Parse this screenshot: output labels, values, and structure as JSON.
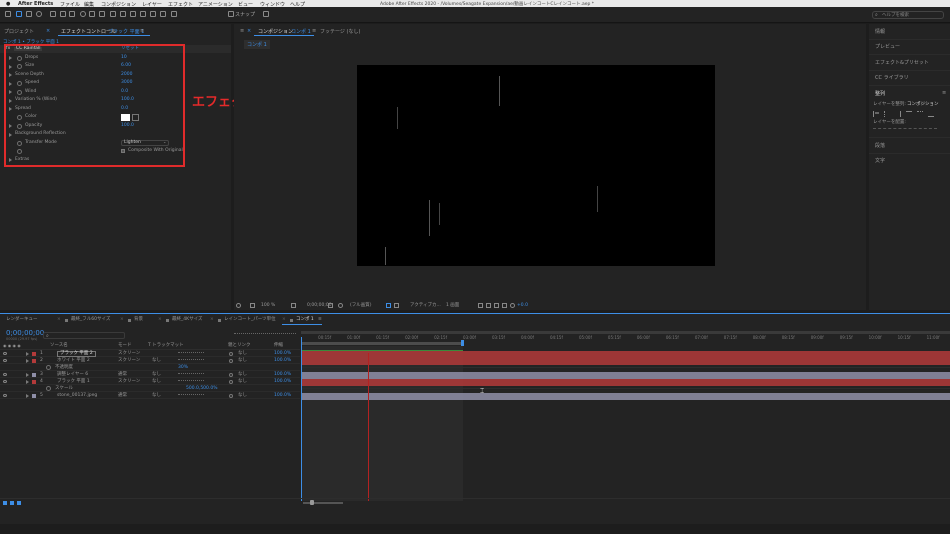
{
  "menubar": {
    "app_name": "After Effects",
    "items": [
      "ファイル",
      "編集",
      "コンポジション",
      "レイヤー",
      "エフェクト",
      "アニメーション",
      "ビュー",
      "ウィンドウ",
      "ヘルプ"
    ],
    "title": "Adobe After Effects 2020 - /Volumes/Seagate Expansion/ae/動画レインコートCレインコート.aep *"
  },
  "toolbar": {
    "snap_label": "スナップ",
    "search_placeholder": "ヘルプを検索"
  },
  "project_panel": {
    "tab_project": "プロジェクト",
    "tab_effect_controls": "エフェクトコントロール",
    "effect_layer": "ブラック 平面 1",
    "breadcrumb": "コンポ 1 • ブラック 平面 1",
    "effect_name": "CC Rainfall",
    "reset_label": "リセット",
    "params": [
      {
        "name": "Drops",
        "value": "10"
      },
      {
        "name": "Size",
        "value": "6.00"
      },
      {
        "name": "Scene Depth",
        "value": "2000"
      },
      {
        "name": "Speed",
        "value": "3000"
      },
      {
        "name": "Wind",
        "value": "0.0"
      },
      {
        "name": "Variation % (Wind)",
        "value": "100.0"
      },
      {
        "name": "Spread",
        "value": "0.0"
      },
      {
        "name": "Color",
        "value": ""
      },
      {
        "name": "Opacity",
        "value": "100.0"
      },
      {
        "name": "Background Reflection",
        "value": ""
      },
      {
        "name": "Transfer Mode",
        "value": "Lighten"
      },
      {
        "name": "",
        "value": "Composite With Original"
      },
      {
        "name": "Extras",
        "value": ""
      }
    ],
    "annotation": "エフェクト設定"
  },
  "composition_panel": {
    "tab_composition": "コンポジション",
    "comp_name": "コンポ 1",
    "tab_footage": "フッテージ (なし)",
    "sub_tab": "コンポ 1",
    "zoom": "100 %",
    "timecode": "0;00;00;00",
    "resolution": "(フル画質)",
    "camera": "アクティブカ...",
    "views": "1 画面",
    "offset": "+0.0"
  },
  "right_panel": {
    "items": [
      "情報",
      "プレビュー",
      "エフェクト&プリセット",
      "CC ライブラリ",
      "整列"
    ],
    "align_to_label": "レイヤーを整列:",
    "align_to_value": "コンポジション",
    "distribute_label": "レイヤーを配置:",
    "extra_items": [
      "段落",
      "文字"
    ]
  },
  "timeline": {
    "tabs": [
      "レンダーキュー",
      "最終_フル60サイズ",
      "背景",
      "最終_4Kサイズ",
      "レインコート_パーツ単位",
      "コンポ 1"
    ],
    "timecode": "0;00;00;00",
    "timecode_sub": "00000 (29.97 fps)",
    "columns": {
      "name": "ソース名",
      "mode": "モード",
      "trkmat": "T トラックマット",
      "parent": "親とリンク",
      "stretch": "伸縮"
    },
    "layers": [
      {
        "num": "1",
        "name": "ブラック 平面 2",
        "mode": "スクリーン",
        "trk": "",
        "parent": "なし",
        "stretch": "100.0%",
        "color": "#b33a3a"
      },
      {
        "num": "2",
        "name": "ホワイト 平面 2",
        "mode": "スクリーン",
        "trk": "なし",
        "parent": "なし",
        "stretch": "100.0%",
        "color": "#b33a3a"
      },
      {
        "num": "",
        "name": "不透明度",
        "mode": "",
        "trk": "",
        "parent": "",
        "stretch": "",
        "color": ""
      },
      {
        "num": "3",
        "name": "調整レイヤー 6",
        "mode": "通常",
        "trk": "なし",
        "parent": "なし",
        "stretch": "100.0%",
        "color": "#8f8fa8"
      },
      {
        "num": "4",
        "name": "ブラック 平面 1",
        "mode": "スクリーン",
        "trk": "なし",
        "parent": "なし",
        "stretch": "100.0%",
        "color": "#b33a3a"
      },
      {
        "num": "",
        "name": "スケール",
        "mode": "",
        "trk": "",
        "parent": "",
        "stretch": "",
        "color": ""
      },
      {
        "num": "5",
        "name": "stone_00137.jpeg",
        "mode": "通常",
        "trk": "なし",
        "parent": "なし",
        "stretch": "100.0%",
        "color": "#8f8fa8"
      }
    ],
    "opacity_value": "30%",
    "scale_value": "500.0,500.0%",
    "ruler": [
      "00:15f",
      "01:00f",
      "01:15f",
      "02:00f",
      "02:15f",
      "03:00f",
      "03:15f",
      "04:00f",
      "04:15f",
      "05:00f",
      "05:15f",
      "06:00f",
      "06:15f",
      "07:00f",
      "07:15f",
      "08:00f",
      "08:15f",
      "09:00f",
      "09:15f",
      "10:00f",
      "10:15f",
      "11:00f"
    ],
    "playhead_position": 0.125,
    "work_area_end": 0.25
  }
}
